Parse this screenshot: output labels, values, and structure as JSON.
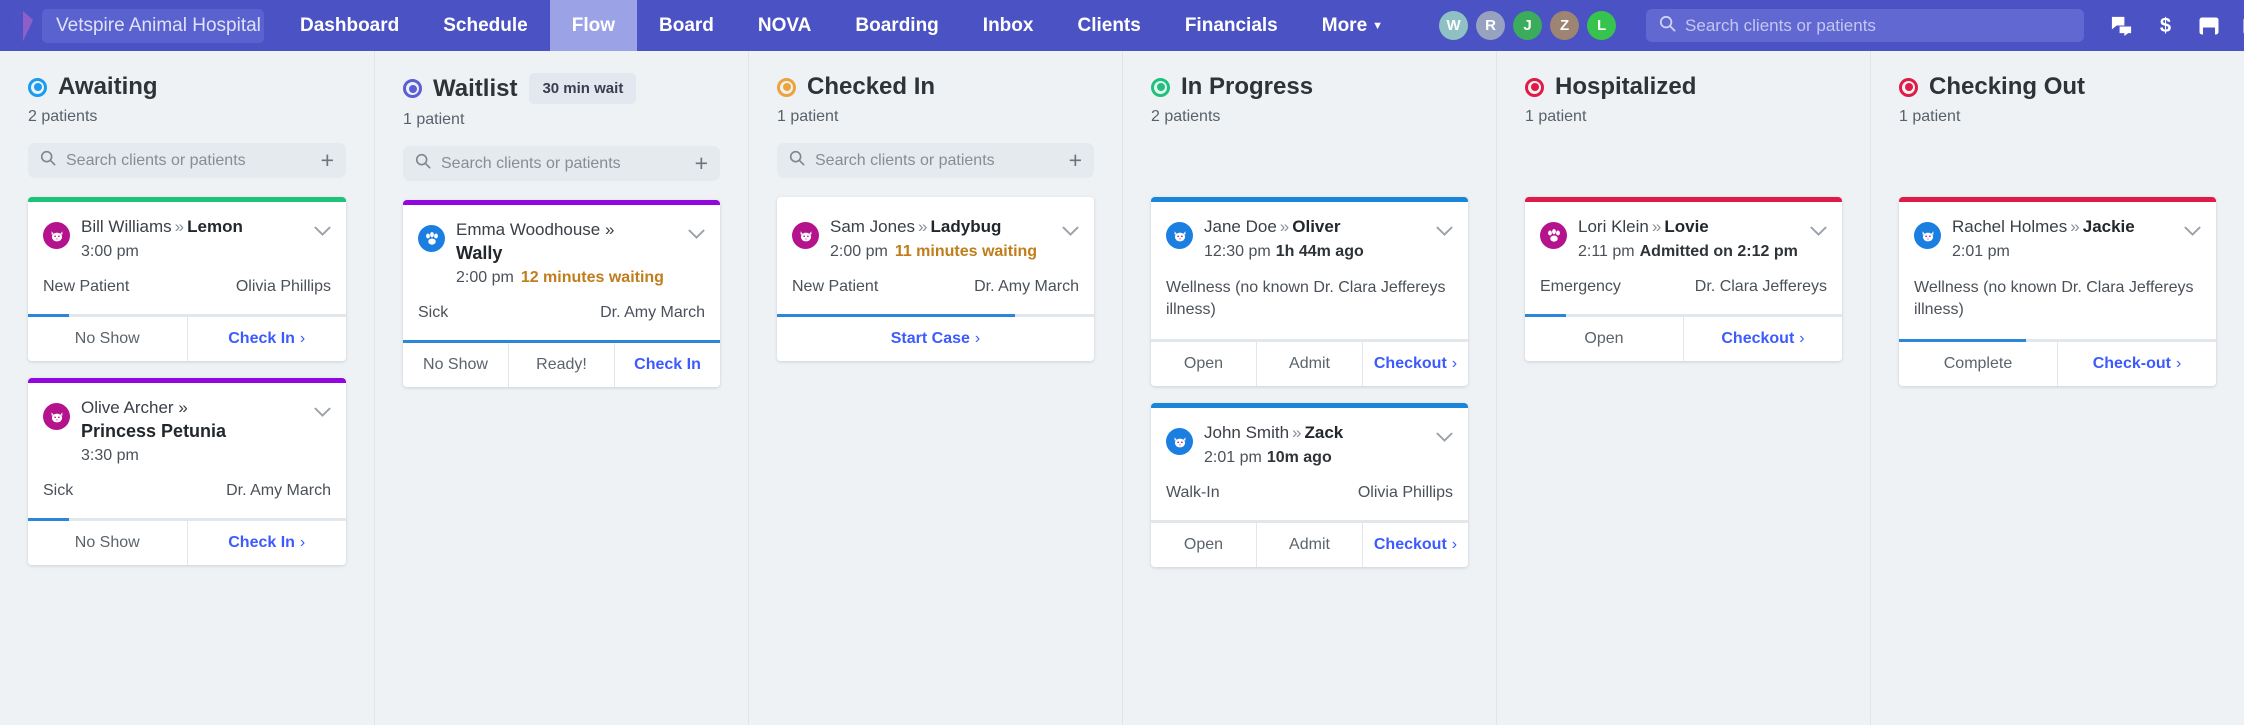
{
  "nav": {
    "practice": "Vetspire Animal Hospital",
    "links": [
      {
        "label": "Dashboard",
        "active": false
      },
      {
        "label": "Schedule",
        "active": false
      },
      {
        "label": "Flow",
        "active": true
      },
      {
        "label": "Board",
        "active": false
      },
      {
        "label": "NOVA",
        "active": false
      },
      {
        "label": "Boarding",
        "active": false
      },
      {
        "label": "Inbox",
        "active": false
      },
      {
        "label": "Clients",
        "active": false
      },
      {
        "label": "Financials",
        "active": false
      },
      {
        "label": "More",
        "active": false,
        "caret": true
      }
    ],
    "avatars": [
      {
        "letter": "W",
        "color": "#8fc0c4"
      },
      {
        "letter": "R",
        "color": "#96a2c0"
      },
      {
        "letter": "J",
        "color": "#3bab5c"
      },
      {
        "letter": "Z",
        "color": "#9d8473"
      },
      {
        "letter": "L",
        "color": "#36c44e"
      }
    ],
    "search_placeholder": "Search clients or patients",
    "search_value": "",
    "icons": [
      "chat-icon",
      "dollar-icon",
      "inbox-icon",
      "tasks-icon",
      "bell-icon",
      "help-icon"
    ]
  },
  "columns": [
    {
      "title": "Awaiting",
      "ring_color": "#1a9ded",
      "count_label": "2 patients",
      "wait_badge": "",
      "search_placeholder": "Search clients or patients",
      "cards": [
        {
          "accent": "#1ec27a",
          "icon": "cat-icon",
          "icon_color": "#b5128d",
          "layout": "inline",
          "owner": "Bill Williams",
          "pet": "Lemon",
          "time": "3:00 pm",
          "status_text": "",
          "reason": "New Patient",
          "provider": "Olivia Phillips",
          "note": "",
          "progress": 13,
          "actions": [
            {
              "label": "No Show",
              "style": "plain"
            },
            {
              "label": "Check In",
              "style": "primary",
              "arrow": "›"
            }
          ]
        },
        {
          "accent": "#9206e0",
          "icon": "cat-icon",
          "icon_color": "#b5128d",
          "layout": "stacked",
          "owner": "Olive Archer",
          "pet": "Princess Petunia",
          "time": "3:30 pm",
          "status_text": "",
          "reason": "Sick",
          "provider": "Dr. Amy March",
          "note": "",
          "progress": 13,
          "actions": [
            {
              "label": "No Show",
              "style": "plain"
            },
            {
              "label": "Check In",
              "style": "primary",
              "arrow": "›"
            }
          ]
        }
      ]
    },
    {
      "title": "Waitlist",
      "ring_color": "#5b5fd6",
      "count_label": "1 patient",
      "wait_badge": "30 min wait",
      "search_placeholder": "Search clients or patients",
      "cards": [
        {
          "accent": "#9206e0",
          "icon": "paw-icon",
          "icon_color": "#1a7fe0",
          "layout": "stacked",
          "owner": "Emma Woodhouse",
          "pet": "Wally",
          "time": "2:00 pm",
          "status_text": "12 minutes waiting",
          "reason": "Sick",
          "provider": "Dr. Amy March",
          "note": "",
          "progress": 100,
          "actions": [
            {
              "label": "No Show",
              "style": "plain"
            },
            {
              "label": "Ready!",
              "style": "plain"
            },
            {
              "label": "Check In",
              "style": "center"
            }
          ]
        }
      ]
    },
    {
      "title": "Checked In",
      "ring_color": "#eda33c",
      "count_label": "1 patient",
      "wait_badge": "",
      "search_placeholder": "Search clients or patients",
      "cards": [
        {
          "accent": "#ffffff",
          "icon": "cat-icon",
          "icon_color": "#b5128d",
          "layout": "inline",
          "owner": "Sam Jones",
          "pet": "Ladybug",
          "time": "2:00 pm",
          "status_text": "11 minutes waiting",
          "reason": "New Patient",
          "provider": "Dr. Amy March",
          "note": "",
          "progress": 75,
          "actions": [
            {
              "label": "Start Case",
              "style": "primary",
              "arrow": "›"
            }
          ]
        }
      ]
    },
    {
      "title": "In Progress",
      "ring_color": "#1ec27a",
      "count_label": "2 patients",
      "wait_badge": "",
      "search_placeholder": "",
      "cards": [
        {
          "accent": "#1a86d8",
          "icon": "cat-icon",
          "icon_color": "#1a7fe0",
          "layout": "inline",
          "owner": "Jane Doe",
          "pet": "Oliver",
          "time": "12:30 pm",
          "status_text": "",
          "ago": "1h 44m ago",
          "reason": "",
          "provider": "",
          "note": "Wellness (no known Dr. Clara Jeffereys illness)",
          "progress": 0,
          "actions": [
            {
              "label": "Open",
              "style": "plain"
            },
            {
              "label": "Admit",
              "style": "plain"
            },
            {
              "label": "Checkout",
              "style": "primary",
              "arrow": "›"
            }
          ]
        },
        {
          "accent": "#1a86d8",
          "icon": "cat-icon",
          "icon_color": "#1a7fe0",
          "layout": "inline",
          "owner": "John Smith",
          "pet": "Zack",
          "time": "2:01 pm",
          "status_text": "",
          "ago": "10m ago",
          "reason": "Walk-In",
          "provider": "Olivia Phillips",
          "note": "",
          "progress": 0,
          "actions": [
            {
              "label": "Open",
              "style": "plain"
            },
            {
              "label": "Admit",
              "style": "plain"
            },
            {
              "label": "Checkout",
              "style": "primary",
              "arrow": "›"
            }
          ]
        }
      ]
    },
    {
      "title": "Hospitalized",
      "ring_color": "#e01b47",
      "count_label": "1 patient",
      "wait_badge": "",
      "search_placeholder": "",
      "cards": [
        {
          "accent": "#e01b47",
          "icon": "paw-icon",
          "icon_color": "#b5128d",
          "layout": "inline",
          "owner": "Lori Klein",
          "pet": "Lovie",
          "time": "2:11 pm",
          "status_text": "",
          "ago": "Admitted on 2:12 pm",
          "reason": "Emergency",
          "provider": "Dr. Clara Jeffereys",
          "note": "",
          "progress": 13,
          "actions": [
            {
              "label": "Open",
              "style": "plain"
            },
            {
              "label": "Checkout",
              "style": "primary",
              "arrow": "›"
            }
          ]
        }
      ]
    },
    {
      "title": "Checking Out",
      "ring_color": "#e01b47",
      "count_label": "1 patient",
      "wait_badge": "",
      "search_placeholder": "",
      "cards": [
        {
          "accent": "#e01b47",
          "icon": "cat-icon",
          "icon_color": "#1a7fe0",
          "layout": "inline",
          "owner": "Rachel Holmes",
          "pet": "Jackie",
          "time": "2:01 pm",
          "status_text": "",
          "reason": "",
          "provider": "",
          "note": "Wellness (no known Dr. Clara Jeffereys illness)",
          "progress": 40,
          "actions": [
            {
              "label": "Complete",
              "style": "plain"
            },
            {
              "label": "Check-out",
              "style": "primary",
              "arrow": "›"
            }
          ]
        }
      ]
    }
  ]
}
